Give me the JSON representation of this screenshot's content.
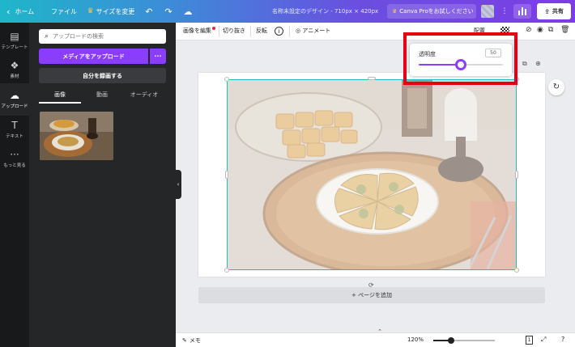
{
  "topbar": {
    "home_label": "ホーム",
    "file_label": "ファイル",
    "resize_label": "サイズを変更",
    "doc_title": "名称未設定のデザイン - 710px × 420px",
    "pro_label": "Canva Proをお試しください",
    "share_label": "共有"
  },
  "leftnav": {
    "items": [
      {
        "label": "テンプレート",
        "icon": "template-icon"
      },
      {
        "label": "素材",
        "icon": "elements-icon"
      },
      {
        "label": "アップロード",
        "icon": "upload-icon"
      },
      {
        "label": "テキスト",
        "icon": "text-icon"
      },
      {
        "label": "もっと見る",
        "icon": "more-icon"
      }
    ]
  },
  "panel": {
    "search_placeholder": "アップロードの検索",
    "upload_label": "メディアをアップロード",
    "record_label": "自分を録画する",
    "tabs": [
      "画像",
      "動画",
      "オーディオ"
    ]
  },
  "toolbar": {
    "edit_image": "画像を編集",
    "crop": "切り抜き",
    "flip": "反転",
    "animate": "アニメート",
    "arrange": "配置"
  },
  "popup": {
    "label": "透明度",
    "value": "50",
    "value_fraction": 0.5
  },
  "canvas": {
    "add_page_label": "+ ページを追加"
  },
  "bottombar": {
    "notes_label": "メモ",
    "zoom_label": "120%",
    "zoom_fraction": 0.29,
    "page_count": "1"
  },
  "colors": {
    "accent": "#8b3dff",
    "highlight": "#e60012",
    "selection": "#22b8c4"
  }
}
